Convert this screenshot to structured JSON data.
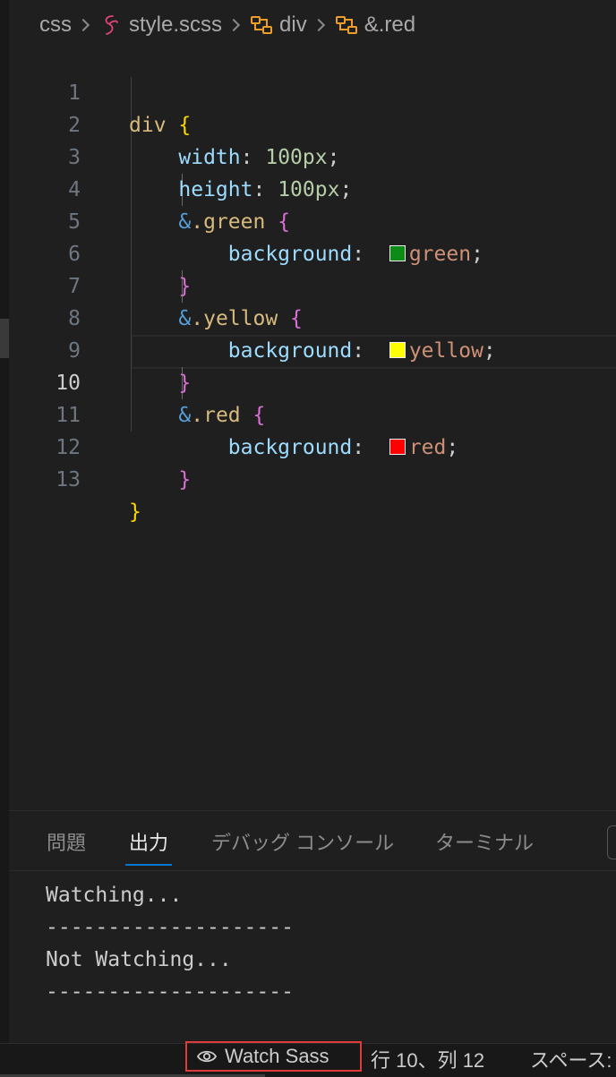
{
  "breadcrumb": {
    "folder": "css",
    "file": "style.scss",
    "symbol1": "div",
    "symbol2": "&.red",
    "file_icon": "sass-icon",
    "symbol_icon": "symbol-class-icon"
  },
  "editor": {
    "active_line": 10,
    "lines": [
      {
        "n": "1"
      },
      {
        "n": "2"
      },
      {
        "n": "3"
      },
      {
        "n": "4"
      },
      {
        "n": "5"
      },
      {
        "n": "6"
      },
      {
        "n": "7"
      },
      {
        "n": "8"
      },
      {
        "n": "9"
      },
      {
        "n": "10"
      },
      {
        "n": "11"
      },
      {
        "n": "12"
      },
      {
        "n": "13"
      }
    ],
    "code": {
      "l1": {
        "sel": "div",
        "brace": "{"
      },
      "l2": {
        "prop": "width",
        "colon": ":",
        "num": "100px",
        "semi": ";"
      },
      "l3": {
        "prop": "height",
        "colon": ":",
        "num": "100px",
        "semi": ";"
      },
      "l4": {
        "amp": "&",
        "sel": ".green",
        "brace": "{"
      },
      "l5": {
        "prop": "background",
        "colon": ":",
        "val": "green",
        "semi": ";",
        "swatch": "#0e8a16"
      },
      "l6": {
        "brace": "}"
      },
      "l7": {
        "amp": "&",
        "sel": ".yellow",
        "brace": "{"
      },
      "l8": {
        "prop": "background",
        "colon": ":",
        "val": "yellow",
        "semi": ";",
        "swatch": "#ffff00"
      },
      "l9": {
        "brace": "}"
      },
      "l10": {
        "amp": "&",
        "sel": ".red",
        "brace": "{"
      },
      "l11": {
        "prop": "background",
        "colon": ":",
        "val": "red",
        "semi": ";",
        "swatch": "#ff0000"
      },
      "l12": {
        "brace": "}"
      },
      "l13": {
        "brace": "}"
      }
    }
  },
  "panel": {
    "tabs": [
      "問題",
      "出力",
      "デバッグ コンソール",
      "ターミナル"
    ],
    "active_tab": "出力",
    "output": [
      "Watching...",
      "--------------------",
      "Not Watching...",
      "--------------------"
    ]
  },
  "statusbar": {
    "watch_label": "Watch Sass",
    "watch_icon": "eye-icon",
    "position": "行 10、列 12",
    "spaces": "スペース:"
  },
  "colors": {
    "accent": "#0078d4",
    "highlight_border": "#e03b3b"
  }
}
